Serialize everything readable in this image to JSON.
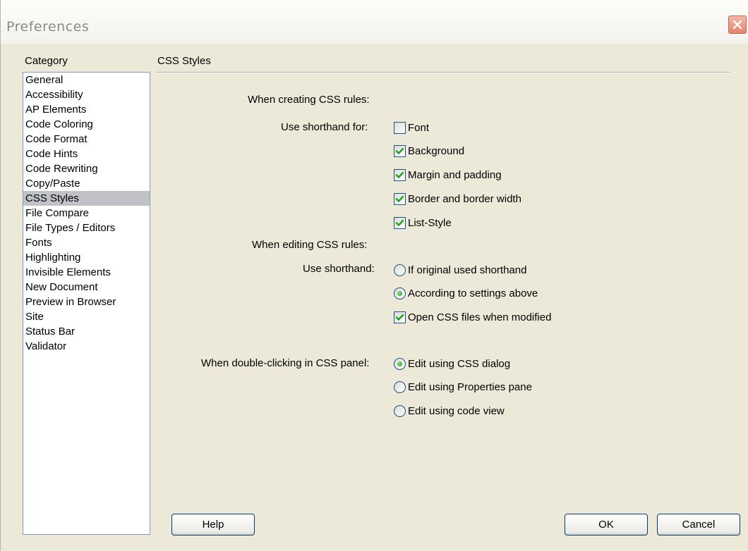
{
  "window": {
    "title": "Preferences"
  },
  "category": {
    "label": "Category",
    "items": [
      "General",
      "Accessibility",
      "AP Elements",
      "Code Coloring",
      "Code Format",
      "Code Hints",
      "Code Rewriting",
      "Copy/Paste",
      "CSS Styles",
      "File Compare",
      "File Types / Editors",
      "Fonts",
      "Highlighting",
      "Invisible Elements",
      "New Document",
      "Preview in Browser",
      "Site",
      "Status Bar",
      "Validator"
    ],
    "selected": "CSS Styles"
  },
  "panel": {
    "title": "CSS Styles",
    "creating": {
      "heading": "When creating CSS rules:",
      "label": "Use shorthand for:",
      "options": [
        {
          "label": "Font",
          "checked": false
        },
        {
          "label": "Background",
          "checked": true
        },
        {
          "label": "Margin and padding",
          "checked": true
        },
        {
          "label": "Border and border width",
          "checked": true
        },
        {
          "label": "List-Style",
          "checked": true
        }
      ]
    },
    "editing": {
      "heading": "When editing CSS rules:",
      "label": "Use shorthand:",
      "radio_1": "If original used shorthand",
      "radio_2": "According to settings above",
      "selected": "According to settings above",
      "open_css_label": "Open CSS files when modified",
      "open_css_checked": true
    },
    "double_click": {
      "label": "When double-clicking in CSS panel:",
      "radio_1": "Edit using CSS dialog",
      "radio_2": "Edit using Properties pane",
      "radio_3": "Edit using code view",
      "selected": "Edit using CSS dialog"
    }
  },
  "buttons": {
    "help": "Help",
    "ok": "OK",
    "cancel": "Cancel"
  },
  "colors": {
    "selection": "#c1c1c8",
    "checkmark": "#21a121",
    "dialog_bg": "#ece9d8",
    "close_button": "#e3866e"
  }
}
